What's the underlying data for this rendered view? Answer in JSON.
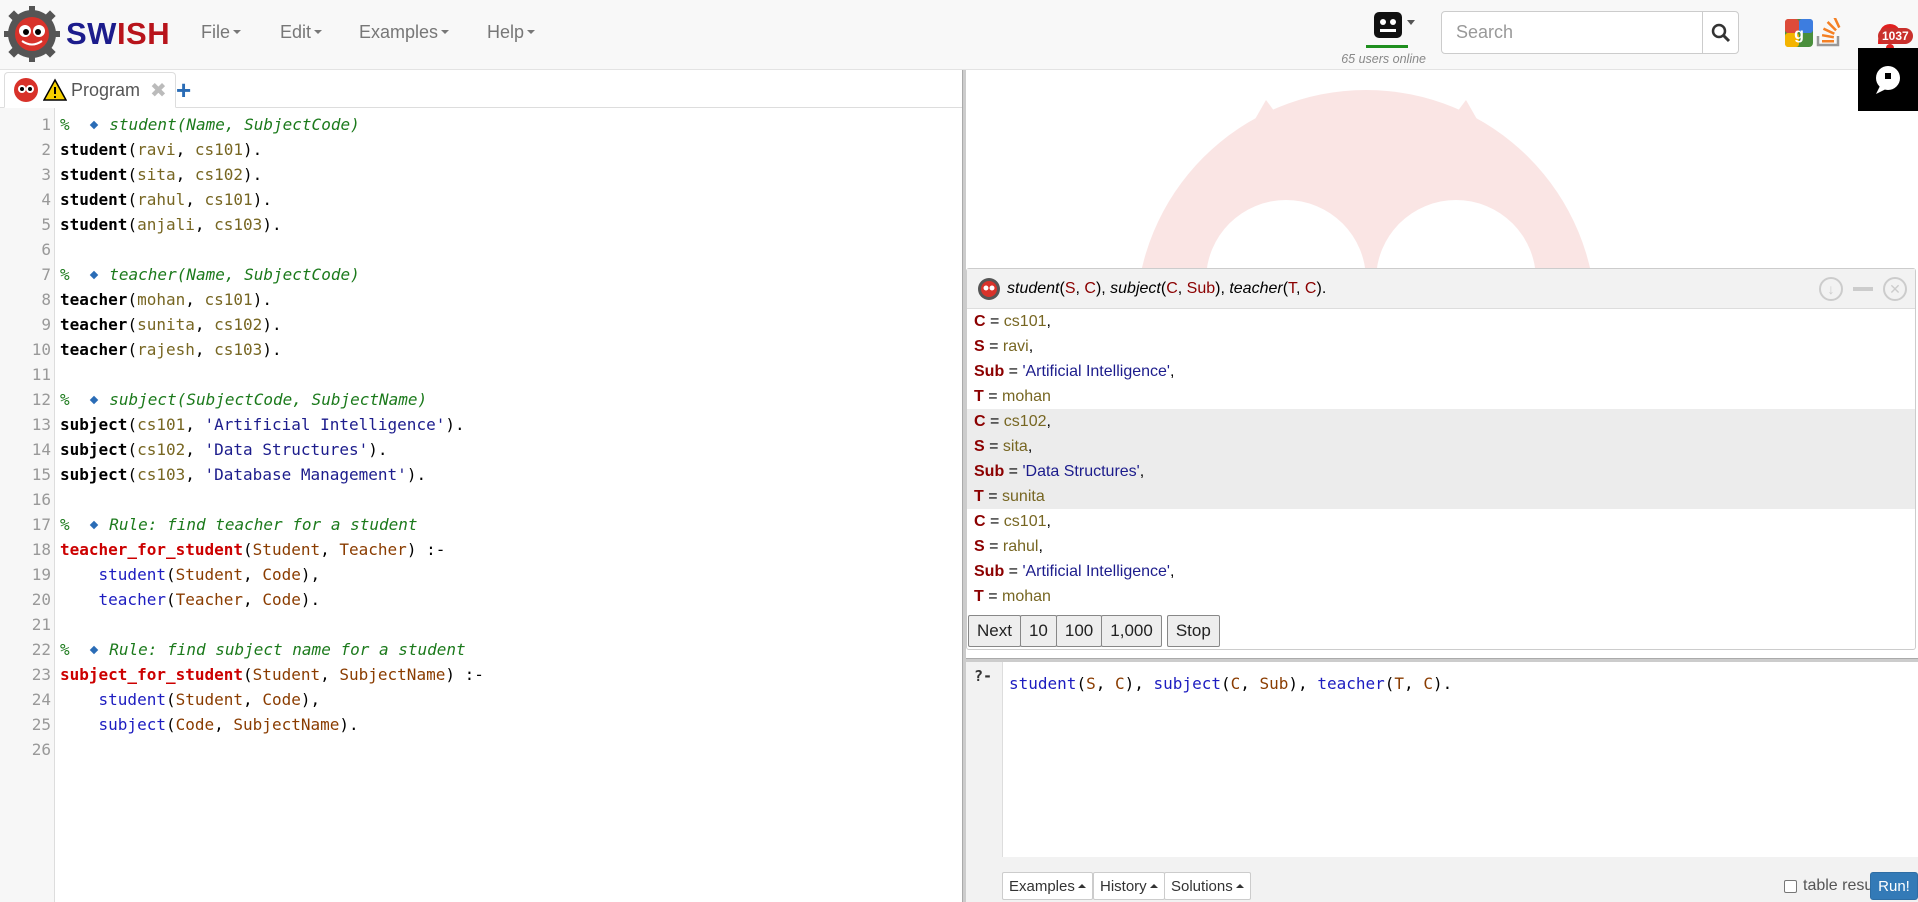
{
  "navbar": {
    "brand_sw": "SW",
    "brand_ish": "ISH",
    "menus": [
      "File",
      "Edit",
      "Examples",
      "Help"
    ],
    "users_online": "65 users online",
    "search_placeholder": "Search",
    "notification_count": "1037"
  },
  "editor": {
    "tab_label": "Program",
    "tab_close": "✖",
    "tab_add": "+"
  },
  "program": [
    {
      "n": "1",
      "segs": [
        [
          "c-comment",
          "% "
        ],
        [
          "diamond",
          ""
        ],
        [
          "c-comment",
          "student(Name, SubjectCode)"
        ]
      ]
    },
    {
      "n": "2",
      "segs": [
        [
          "c-fact",
          "student"
        ],
        [
          "c-punc",
          "("
        ],
        [
          "c-atom",
          "ravi"
        ],
        [
          "c-punc",
          ", "
        ],
        [
          "c-atom",
          "cs101"
        ],
        [
          "c-punc",
          ")."
        ]
      ]
    },
    {
      "n": "3",
      "segs": [
        [
          "c-fact",
          "student"
        ],
        [
          "c-punc",
          "("
        ],
        [
          "c-atom",
          "sita"
        ],
        [
          "c-punc",
          ", "
        ],
        [
          "c-atom",
          "cs102"
        ],
        [
          "c-punc",
          ")."
        ]
      ]
    },
    {
      "n": "4",
      "segs": [
        [
          "c-fact",
          "student"
        ],
        [
          "c-punc",
          "("
        ],
        [
          "c-atom",
          "rahul"
        ],
        [
          "c-punc",
          ", "
        ],
        [
          "c-atom",
          "cs101"
        ],
        [
          "c-punc",
          ")."
        ]
      ]
    },
    {
      "n": "5",
      "segs": [
        [
          "c-fact",
          "student"
        ],
        [
          "c-punc",
          "("
        ],
        [
          "c-atom",
          "anjali"
        ],
        [
          "c-punc",
          ", "
        ],
        [
          "c-atom",
          "cs103"
        ],
        [
          "c-punc",
          ")."
        ]
      ]
    },
    {
      "n": "6",
      "segs": []
    },
    {
      "n": "7",
      "segs": [
        [
          "c-comment",
          "% "
        ],
        [
          "diamond",
          ""
        ],
        [
          "c-comment",
          "teacher(Name, SubjectCode)"
        ]
      ]
    },
    {
      "n": "8",
      "segs": [
        [
          "c-fact",
          "teacher"
        ],
        [
          "c-punc",
          "("
        ],
        [
          "c-atom",
          "mohan"
        ],
        [
          "c-punc",
          ", "
        ],
        [
          "c-atom",
          "cs101"
        ],
        [
          "c-punc",
          ")."
        ]
      ]
    },
    {
      "n": "9",
      "segs": [
        [
          "c-fact",
          "teacher"
        ],
        [
          "c-punc",
          "("
        ],
        [
          "c-atom",
          "sunita"
        ],
        [
          "c-punc",
          ", "
        ],
        [
          "c-atom",
          "cs102"
        ],
        [
          "c-punc",
          ")."
        ]
      ]
    },
    {
      "n": "10",
      "segs": [
        [
          "c-fact",
          "teacher"
        ],
        [
          "c-punc",
          "("
        ],
        [
          "c-atom",
          "rajesh"
        ],
        [
          "c-punc",
          ", "
        ],
        [
          "c-atom",
          "cs103"
        ],
        [
          "c-punc",
          ")."
        ]
      ]
    },
    {
      "n": "11",
      "segs": []
    },
    {
      "n": "12",
      "segs": [
        [
          "c-comment",
          "% "
        ],
        [
          "diamond",
          ""
        ],
        [
          "c-comment",
          "subject(SubjectCode, SubjectName)"
        ]
      ]
    },
    {
      "n": "13",
      "segs": [
        [
          "c-fact",
          "subject"
        ],
        [
          "c-punc",
          "("
        ],
        [
          "c-atom",
          "cs101"
        ],
        [
          "c-punc",
          ", "
        ],
        [
          "c-str",
          "'Artificial Intelligence'"
        ],
        [
          "c-punc",
          ")."
        ]
      ]
    },
    {
      "n": "14",
      "segs": [
        [
          "c-fact",
          "subject"
        ],
        [
          "c-punc",
          "("
        ],
        [
          "c-atom",
          "cs102"
        ],
        [
          "c-punc",
          ", "
        ],
        [
          "c-str",
          "'Data Structures'"
        ],
        [
          "c-punc",
          ")."
        ]
      ]
    },
    {
      "n": "15",
      "segs": [
        [
          "c-fact",
          "subject"
        ],
        [
          "c-punc",
          "("
        ],
        [
          "c-atom",
          "cs103"
        ],
        [
          "c-punc",
          ", "
        ],
        [
          "c-str",
          "'Database Management'"
        ],
        [
          "c-punc",
          ")."
        ]
      ]
    },
    {
      "n": "16",
      "segs": []
    },
    {
      "n": "17",
      "segs": [
        [
          "c-comment",
          "% "
        ],
        [
          "diamond",
          ""
        ],
        [
          "c-comment",
          "Rule: find teacher for a student"
        ]
      ]
    },
    {
      "n": "18",
      "segs": [
        [
          "c-head",
          "teacher_for_student"
        ],
        [
          "c-punc",
          "("
        ],
        [
          "c-var",
          "Student"
        ],
        [
          "c-punc",
          ", "
        ],
        [
          "c-var",
          "Teacher"
        ],
        [
          "c-punc",
          ") :-"
        ]
      ]
    },
    {
      "n": "19",
      "segs": [
        [
          "c-punc",
          "    "
        ],
        [
          "c-goal",
          "student"
        ],
        [
          "c-punc",
          "("
        ],
        [
          "c-var",
          "Student"
        ],
        [
          "c-punc",
          ", "
        ],
        [
          "c-var",
          "Code"
        ],
        [
          "c-punc",
          "),"
        ]
      ]
    },
    {
      "n": "20",
      "segs": [
        [
          "c-punc",
          "    "
        ],
        [
          "c-goal",
          "teacher"
        ],
        [
          "c-punc",
          "("
        ],
        [
          "c-var",
          "Teacher"
        ],
        [
          "c-punc",
          ", "
        ],
        [
          "c-var",
          "Code"
        ],
        [
          "c-punc",
          ")."
        ]
      ]
    },
    {
      "n": "21",
      "segs": []
    },
    {
      "n": "22",
      "segs": [
        [
          "c-comment",
          "% "
        ],
        [
          "diamond",
          ""
        ],
        [
          "c-comment",
          "Rule: find subject name for a student"
        ]
      ]
    },
    {
      "n": "23",
      "segs": [
        [
          "c-head",
          "subject_for_student"
        ],
        [
          "c-punc",
          "("
        ],
        [
          "c-var",
          "Student"
        ],
        [
          "c-punc",
          ", "
        ],
        [
          "c-var",
          "SubjectName"
        ],
        [
          "c-punc",
          ") :-"
        ]
      ]
    },
    {
      "n": "24",
      "segs": [
        [
          "c-punc",
          "    "
        ],
        [
          "c-goal",
          "student"
        ],
        [
          "c-punc",
          "("
        ],
        [
          "c-var",
          "Student"
        ],
        [
          "c-punc",
          ", "
        ],
        [
          "c-var",
          "Code"
        ],
        [
          "c-punc",
          "),"
        ]
      ]
    },
    {
      "n": "25",
      "segs": [
        [
          "c-punc",
          "    "
        ],
        [
          "c-goal",
          "subject"
        ],
        [
          "c-punc",
          "("
        ],
        [
          "c-var",
          "Code"
        ],
        [
          "c-punc",
          ", "
        ],
        [
          "c-var",
          "SubjectName"
        ],
        [
          "c-punc",
          ")."
        ]
      ]
    },
    {
      "n": "26",
      "segs": []
    }
  ],
  "answer": {
    "query_parts": [
      [
        "q",
        "student"
      ],
      [
        "p",
        "("
      ],
      [
        "v",
        "S"
      ],
      [
        "p",
        ", "
      ],
      [
        "v",
        "C"
      ],
      [
        "p",
        "), "
      ],
      [
        "q",
        "subject"
      ],
      [
        "p",
        "("
      ],
      [
        "v",
        "C"
      ],
      [
        "p",
        ", "
      ],
      [
        "v",
        "Sub"
      ],
      [
        "p",
        "), "
      ],
      [
        "q",
        "teacher"
      ],
      [
        "p",
        "("
      ],
      [
        "v",
        "T"
      ],
      [
        "p",
        ", "
      ],
      [
        "v",
        "C"
      ],
      [
        "p",
        ")."
      ]
    ],
    "solutions": [
      [
        [
          "C",
          "atom",
          "cs101",
          ","
        ],
        [
          "S",
          "atom",
          "ravi",
          ","
        ],
        [
          "Sub",
          "str",
          "'Artificial Intelligence'",
          ","
        ],
        [
          "T",
          "atom",
          "mohan",
          ""
        ]
      ],
      [
        [
          "C",
          "atom",
          "cs102",
          ","
        ],
        [
          "S",
          "atom",
          "sita",
          ","
        ],
        [
          "Sub",
          "str",
          "'Data Structures'",
          ","
        ],
        [
          "T",
          "atom",
          "sunita",
          ""
        ]
      ],
      [
        [
          "C",
          "atom",
          "cs101",
          ","
        ],
        [
          "S",
          "atom",
          "rahul",
          ","
        ],
        [
          "Sub",
          "str",
          "'Artificial Intelligence'",
          ","
        ],
        [
          "T",
          "atom",
          "mohan",
          ""
        ]
      ]
    ],
    "buttons": {
      "next": "Next",
      "ten": "10",
      "hundred": "100",
      "thousand": "1,000",
      "stop": "Stop"
    }
  },
  "query": {
    "prompt": "?-",
    "parts": [
      [
        "c-goal",
        "student"
      ],
      [
        "c-punc",
        "("
      ],
      [
        "c-var",
        "S"
      ],
      [
        "c-punc",
        ", "
      ],
      [
        "c-var",
        "C"
      ],
      [
        "c-punc",
        "), "
      ],
      [
        "c-goal",
        "subject"
      ],
      [
        "c-punc",
        "("
      ],
      [
        "c-var",
        "C"
      ],
      [
        "c-punc",
        ", "
      ],
      [
        "c-var",
        "Sub"
      ],
      [
        "c-punc",
        "), "
      ],
      [
        "c-goal",
        "teacher"
      ],
      [
        "c-punc",
        "("
      ],
      [
        "c-var",
        "T"
      ],
      [
        "c-punc",
        ", "
      ],
      [
        "c-var",
        "C"
      ],
      [
        "c-punc",
        ")."
      ]
    ],
    "examples_label": "Examples",
    "history_label": "History",
    "solutions_label": "Solutions",
    "table_results_label": "table results",
    "run_label": "Run!"
  },
  "colors": {
    "brand_blue": "#1c1c8c",
    "brand_red": "#b8141b",
    "run_blue": "#337ab7",
    "var_red": "#8b0000"
  }
}
